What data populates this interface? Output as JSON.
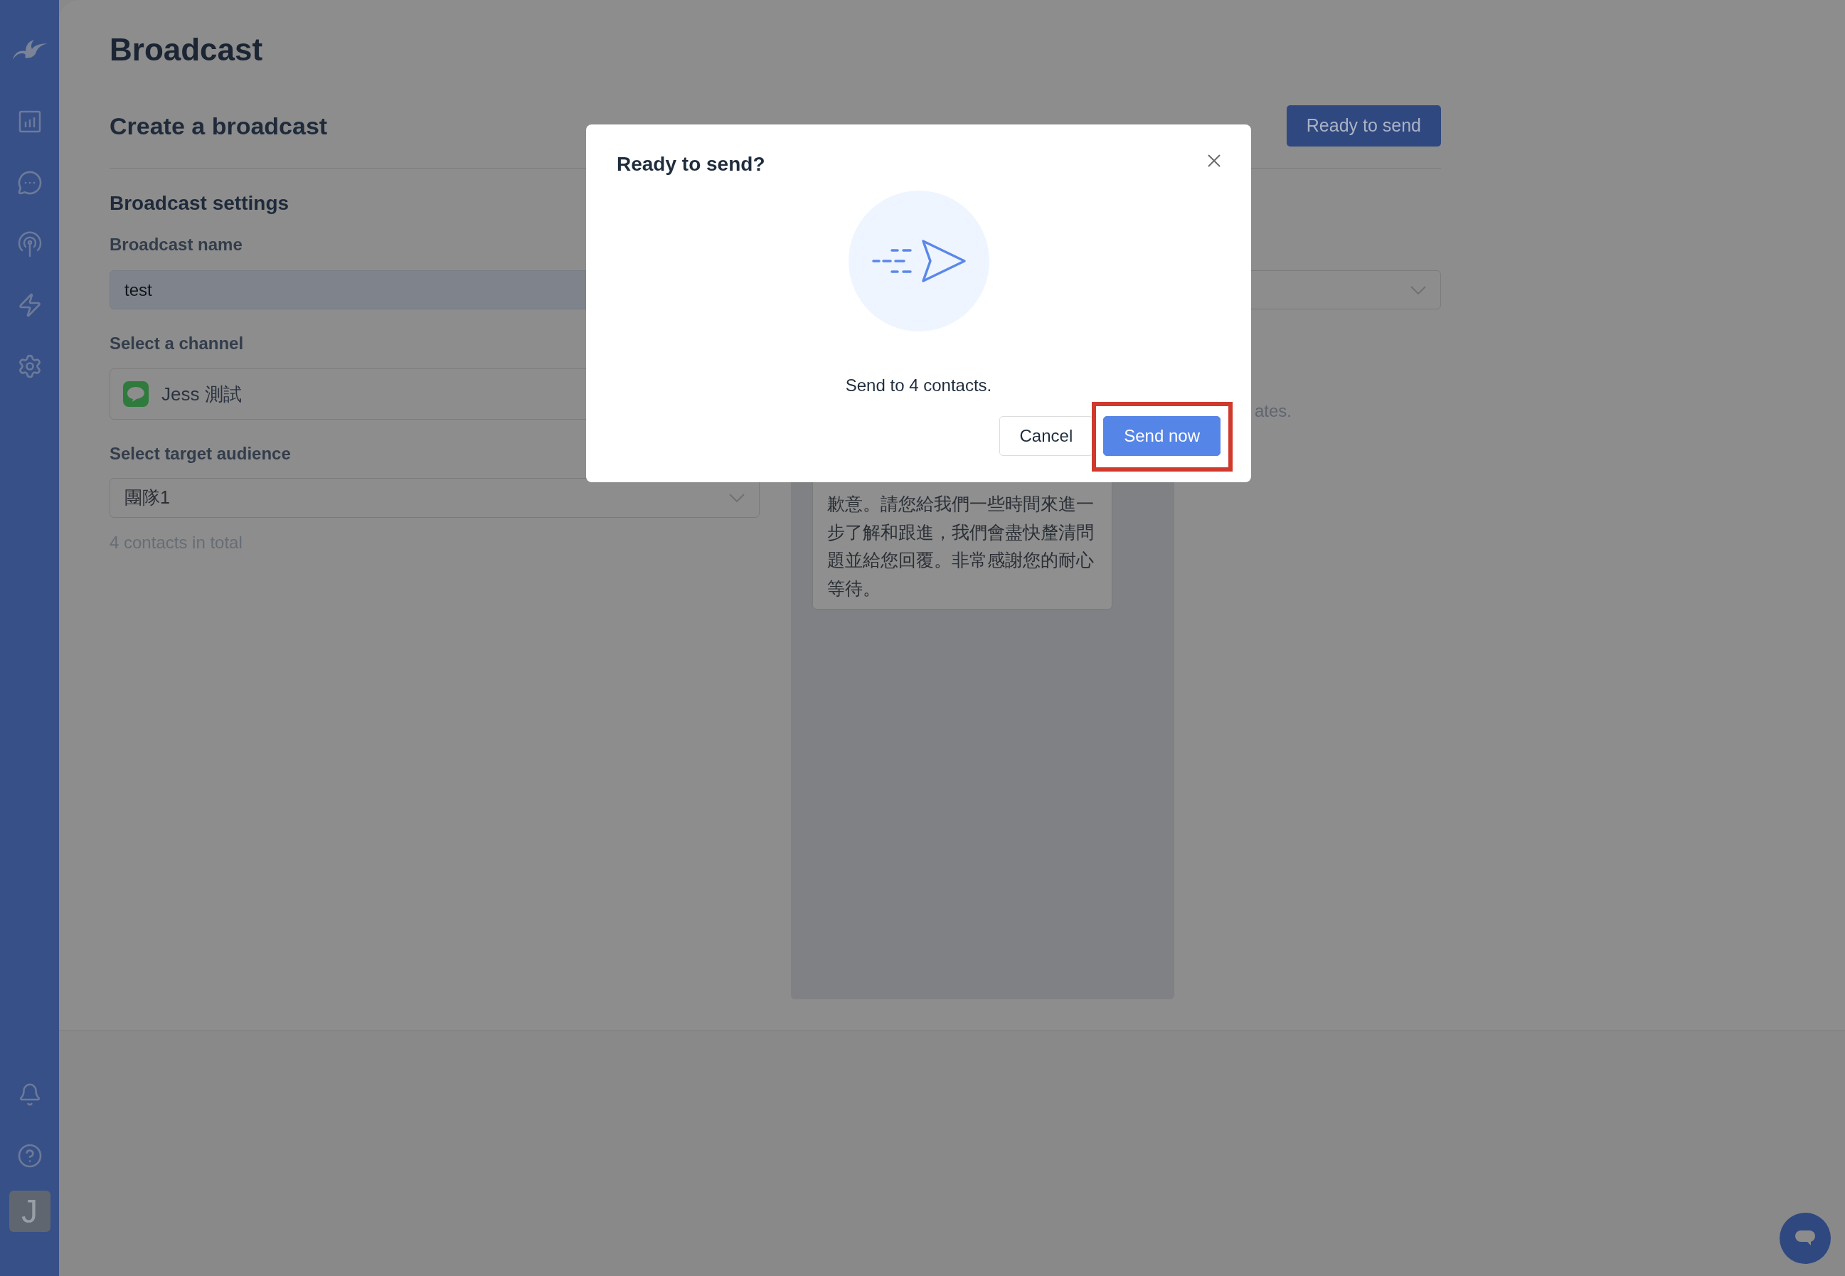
{
  "sidebar": {
    "avatar": "J"
  },
  "page": {
    "title": "Broadcast",
    "subtitle": "Create a broadcast",
    "ready_button": "Ready to send"
  },
  "settings": {
    "heading": "Broadcast settings",
    "fields": [
      {
        "kind": "text",
        "label": "Broadcast name",
        "value": "test"
      },
      {
        "kind": "channel",
        "label": "Select a channel",
        "value": "Jess 測試"
      },
      {
        "kind": "select",
        "label": "Select target audience",
        "value": "團隊1"
      }
    ],
    "audience_note": "4 contacts in total"
  },
  "side_note": "ates.",
  "preview": {
    "message": "歉意。請您給我們一些時間來進一步了解和跟進，我們會盡快釐清問題並給您回覆。非常感謝您的耐心等待。"
  },
  "dialog": {
    "title": "Ready to send?",
    "message": "Send to 4 contacts.",
    "buttons": [
      {
        "kind": "secondary",
        "label": "Cancel",
        "highlighted": false
      },
      {
        "kind": "primary",
        "label": "Send now",
        "highlighted": true
      }
    ]
  }
}
